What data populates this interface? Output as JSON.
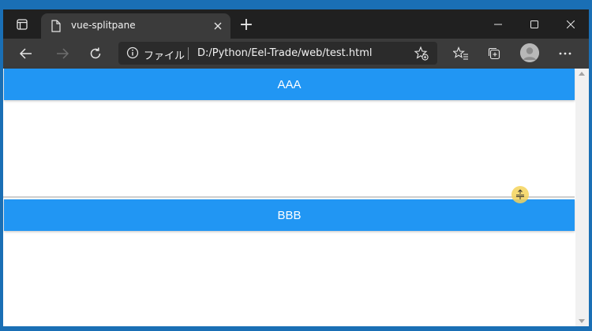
{
  "browser": {
    "tab": {
      "title": "vue-splitpane",
      "close_icon": "close-icon"
    },
    "new_tab_label": "+",
    "window_controls": [
      "minimize-icon",
      "maximize-icon",
      "close-icon"
    ],
    "address_bar": {
      "site_info_label": "ファイル",
      "url": "D:/Python/Eel-Trade/web/test.html"
    },
    "icons": {
      "tab_actions": "tab-actions-icon",
      "back": "back-arrow-icon",
      "forward": "forward-arrow-icon",
      "refresh": "refresh-icon",
      "info": "info-icon",
      "add_favorite": "add-favorite-icon",
      "favorites": "favorites-icon",
      "collections": "collections-icon",
      "profile": "profile-icon",
      "more": "more-icon"
    }
  },
  "page": {
    "top_pane": {
      "title": "AAA"
    },
    "bottom_pane": {
      "title": "BBB"
    },
    "splitter_cursor_icon": "row-resize-cursor-icon"
  },
  "colors": {
    "pane_header": "#2196f3",
    "titlebar": "#202020",
    "toolbar": "#3b3b3b"
  }
}
